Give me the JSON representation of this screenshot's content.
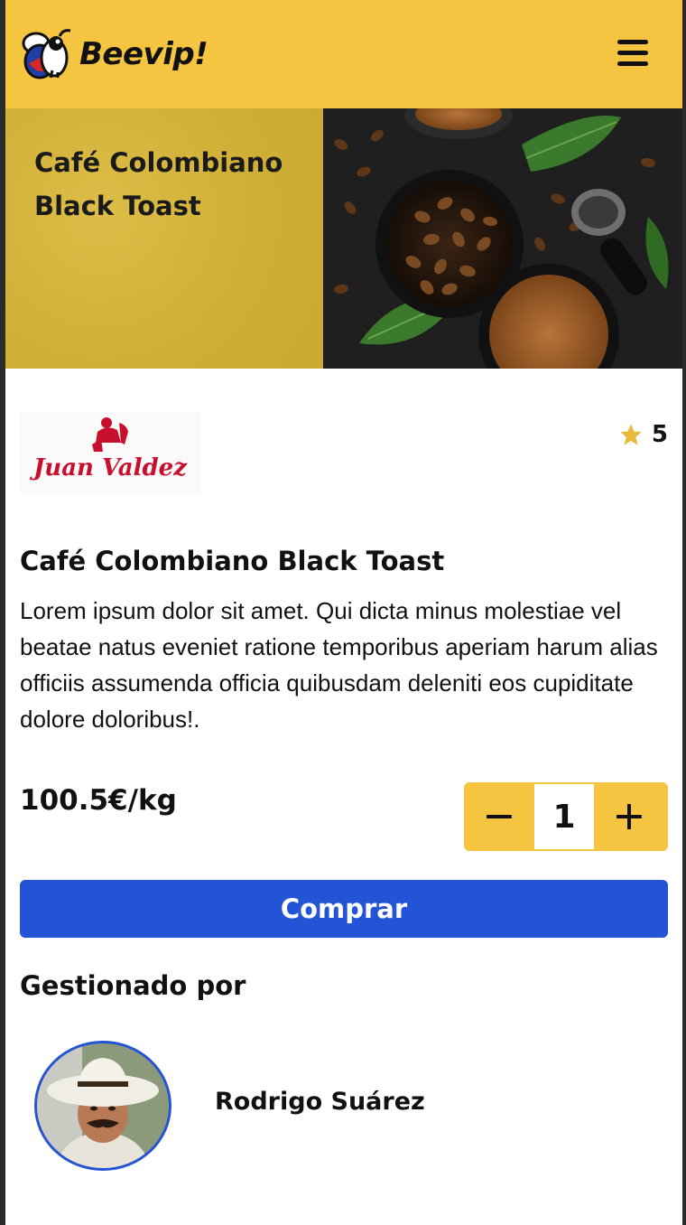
{
  "header": {
    "brand": "Beevip!",
    "logo_icon": "bee-icon",
    "menu_icon": "hamburger-menu-icon"
  },
  "hero": {
    "title": "Café Colombiano Black Toast",
    "image": "coffee-beans-image"
  },
  "product": {
    "brand_logo_text": "Juan Valdez",
    "rating": "5",
    "rating_icon": "star-icon",
    "title": "Café Colombiano Black Toast",
    "description": "Lorem ipsum dolor sit amet. Qui dicta minus molestiae vel beatae natus eveniet ratione temporibus aperiam harum alias officiis assumenda officia quibusdam deleniti eos cupiditate dolore doloribus!.",
    "price": "100.5€/kg",
    "quantity": "1",
    "buy_label": "Comprar"
  },
  "manager": {
    "section_title": "Gestionado por",
    "name": "Rodrigo Suárez"
  },
  "colors": {
    "accent_yellow": "#f5c542",
    "primary_blue": "#2454d6",
    "brand_red": "#c8102e"
  }
}
